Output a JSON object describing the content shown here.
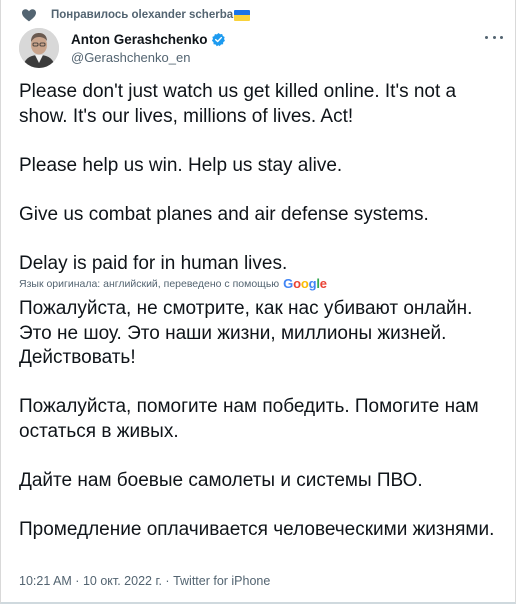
{
  "liked_by": {
    "text": "Понравилось olexander scherba"
  },
  "author": {
    "name": "Anton Gerashchenko",
    "handle": "@Gerashchenko_en"
  },
  "tweet": {
    "paragraphs": [
      "Please don't just watch us get killed online. It's not a show. It's our lives, millions of lives. Act!",
      "Please help us win. Help us stay alive.",
      "Give us combat planes and air defense systems.",
      "Delay is paid for in human lives."
    ]
  },
  "translation": {
    "note": "Язык оригинала: английский, переведено с помощью",
    "provider": "Google",
    "paragraphs": [
      "Пожалуйста, не смотрите, как нас убивают онлайн. Это не шоу. Это наши жизни, миллионы жизней. Действовать!",
      "Пожалуйста, помогите нам победить. Помогите нам остаться в живых.",
      "Дайте нам боевые самолеты и системы ПВО.",
      "Промедление оплачивается человеческими жизнями."
    ]
  },
  "meta": {
    "time": "10:21 AM",
    "separator1": " · ",
    "date": "10 окт. 2022 г.",
    "separator2": " · ",
    "source": "Twitter for iPhone"
  },
  "colors": {
    "text": "#0f1419",
    "muted": "#536471",
    "verified": "#1d9bf0",
    "flag_blue": "#1a73e8",
    "flag_yellow": "#f9d23c"
  },
  "icons": {
    "heart": "heart-icon",
    "verified": "verified-badge-icon",
    "more": "more-icon"
  }
}
